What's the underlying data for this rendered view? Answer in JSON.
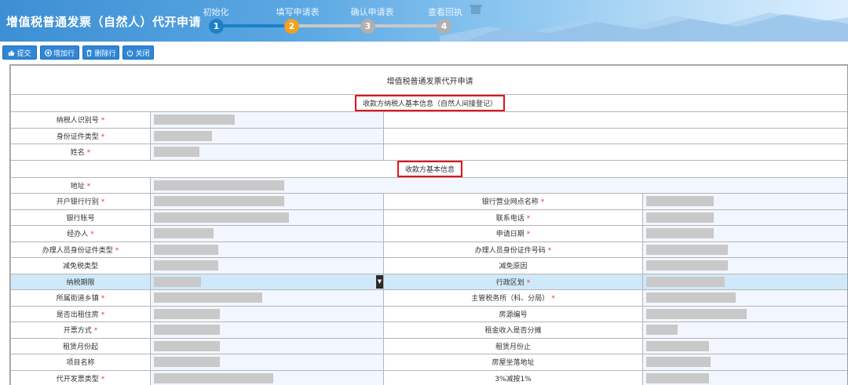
{
  "app": {
    "title": "增值税普通发票（自然人）代开申请"
  },
  "steps": [
    {
      "label": "初始化",
      "number": "1",
      "state": "done"
    },
    {
      "label": "填写申请表",
      "number": "2",
      "state": "current"
    },
    {
      "label": "确认申请表",
      "number": "3",
      "state": "pending"
    },
    {
      "label": "查看回执",
      "number": "4",
      "state": "pending"
    }
  ],
  "toolbar": {
    "submit_label": "提交",
    "add_row_label": "增加行",
    "delete_row_label": "删除行",
    "close_label": "关闭"
  },
  "form": {
    "title": "增值税普通发票代开申请",
    "section_payee_taxpayer": "收款方纳税人基本信息（自然人间接登记）",
    "section_payee_basic": "收款方基本信息",
    "required_mark": "*",
    "select_arrow": "▼",
    "fields": {
      "taxpayer_id": "纳税人识别号",
      "id_type": "身份证件类型",
      "name": "姓名",
      "address": "地址",
      "bank": "开户银行行别",
      "bank_branch": "银行营业网点名称",
      "bank_account": "银行账号",
      "phone": "联系电话",
      "handler": "经办人",
      "apply_date": "申请日期",
      "handler_id_type": "办理人员身份证件类型",
      "handler_id_no": "办理人员身份证件号码",
      "tax_reduction_type": "减免税类型",
      "reduction_reason": "减免原因",
      "tax_period": "纳税期限",
      "admin_division": "行政区划",
      "street": "所属街道乡镇",
      "tax_office": "主管税务所（科、分局）",
      "rental_housing": "是否出租住房",
      "house_no": "房源编号",
      "invoice_method": "开票方式",
      "rent_split": "租金收入是否分摊",
      "lease_start": "租赁月份起",
      "lease_end": "租赁月份止",
      "project_name": "项目名称",
      "house_location": "房屋坐落地址",
      "invoice_type": "代开发票类型",
      "reduce_rate": "3%减按1%"
    }
  },
  "colors": {
    "accent": "#2f86d6",
    "step_done": "#1e7fc7",
    "step_current": "#f2a11f",
    "step_pending": "#b0b0b0",
    "required": "#e23b3b",
    "highlight_box": "#e0141c",
    "row_highlight": "#cfe9fb"
  }
}
